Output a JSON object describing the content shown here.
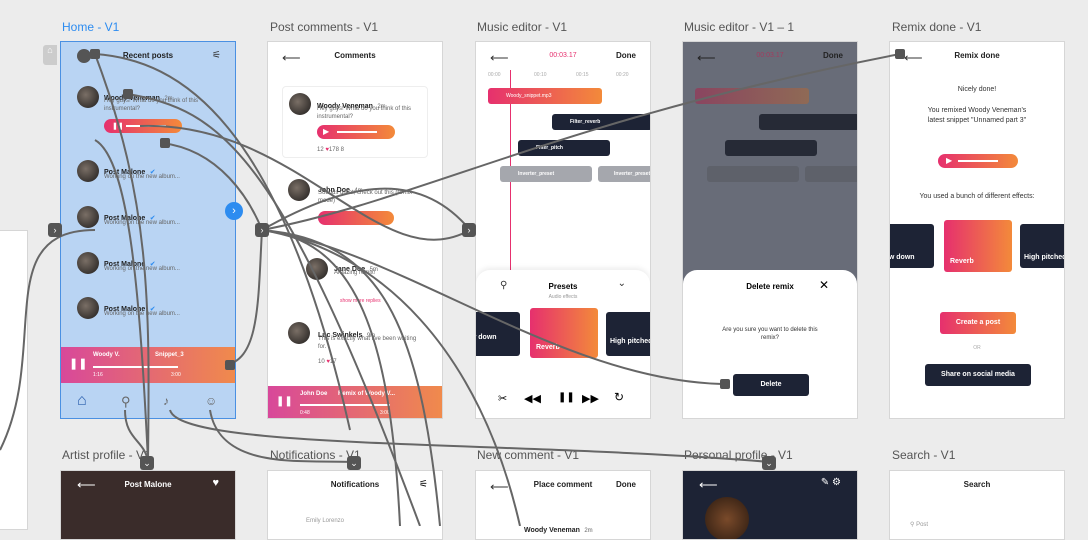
{
  "frames": {
    "home": {
      "title": "Home - V1",
      "header": "Recent posts",
      "posts": [
        {
          "author": "Woody Veneman",
          "time": "2m",
          "text": "Hey guys! What do you think of this instrumental?"
        },
        {
          "author": "Post Malone",
          "time": "5m",
          "text": "Working on the new album..."
        },
        {
          "author": "Post Malone",
          "time": "5m",
          "text": "Working on the new album..."
        },
        {
          "author": "Post Malone",
          "time": "5m",
          "text": "Working on the new album..."
        },
        {
          "author": "Post Malone",
          "time": "5m",
          "text": "Working on the new album..."
        }
      ],
      "player": {
        "artist": "Woody V.",
        "track": "Snippet_3",
        "elapsed": "1:16",
        "total": "3:00"
      }
    },
    "comments": {
      "title": "Post comments - V1",
      "header": "Comments",
      "main": {
        "author": "Woody Veneman",
        "time": "2m",
        "text": "Hey guys! What do you think of this instrumental?",
        "comments": "12",
        "likes": "178",
        "shares": "8"
      },
      "c1": {
        "author": "John Doe",
        "time": "4m",
        "text": "Sounds great, check out this (remix mode)"
      },
      "c2": {
        "author": "Jane Doe",
        "time": "5m",
        "text": "Amazing remix!"
      },
      "more": "show more replies",
      "c3": {
        "author": "Luc Swinkels",
        "time": "9m",
        "text": "This is exactly what I've been waiting for.",
        "comments": "10",
        "likes": "17"
      },
      "player": {
        "artist": "John Doe",
        "track": "Remix of Woody V...",
        "elapsed": "0:48",
        "total": "3:00"
      }
    },
    "editor": {
      "title": "Music editor - V1",
      "time": "00:03.17",
      "done": "Done",
      "ticks": [
        "00:00",
        "00:10",
        "00:15",
        "00:20"
      ],
      "tracks": [
        "Woody_snippet.mp3",
        "Filter_reverb",
        "Filter_pitch",
        "Inverter_preset",
        "Inverter_preset"
      ],
      "presets": "Presets",
      "presets_sub": "Audio effects",
      "chips": [
        {
          "t": "Filter",
          "v": "Slow down"
        },
        {
          "t": "Filter",
          "v": "Reverb"
        },
        {
          "t": "Filter",
          "v": "High pitched"
        }
      ]
    },
    "editor2": {
      "title": "Music editor - V1 – 1",
      "time": "00:03.17",
      "done": "Done",
      "modal_title": "Delete remix",
      "modal_text": "Are you sure you want to delete this remix?",
      "delete": "Delete"
    },
    "remix": {
      "title": "Remix done - V1",
      "header": "Remix done",
      "line1": "Nicely done!",
      "line2": "You remixed Woody Veneman's latest snippet \"Unnamed part 3\"",
      "effects": "You used a bunch of different effects:",
      "chips": [
        {
          "t": "Filter",
          "v": "Slow down"
        },
        {
          "t": "Filter",
          "v": "Reverb"
        },
        {
          "t": "Filter",
          "v": "High pitched"
        }
      ],
      "create": "Create a post",
      "or": "OR",
      "share": "Share on social media"
    },
    "artist": {
      "title": "Artist profile - V1",
      "name": "Post Malone"
    },
    "notifications": {
      "title": "Notifications - V1",
      "header": "Notifications",
      "first": "Emily Lorenzo"
    },
    "newcomment": {
      "title": "New comment - V1",
      "header": "Place comment",
      "done": "Done",
      "author": "Woody Veneman",
      "time": "2m"
    },
    "personal": {
      "title": "Personal profile - V1"
    },
    "search": {
      "title": "Search - V1",
      "header": "Search",
      "placeholder": "Post"
    }
  },
  "colors": {
    "selection": "#4a90e2",
    "accent_start": "#e6306e",
    "accent_end": "#f38a3a",
    "dark": "#1d2335"
  }
}
